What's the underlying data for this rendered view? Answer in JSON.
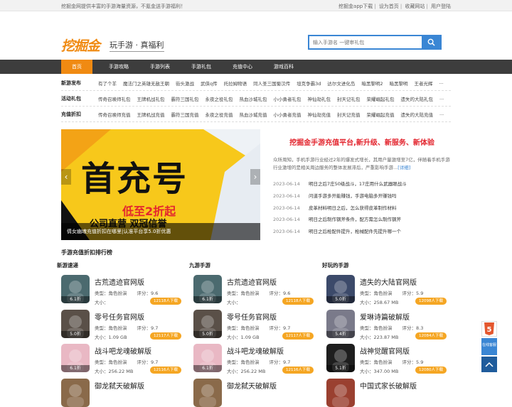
{
  "topbar": {
    "left_text": "挖掘金网提供丰富的手游海量资源，不氪金送手游福利！",
    "right_links": [
      "挖掘金app下载",
      "设为首页",
      "收藏网站",
      "用户登陆"
    ]
  },
  "header": {
    "logo_text": "挖掘金",
    "slogan": "玩手游 · 真福利",
    "search_placeholder": "输入手游名 一键审礼包"
  },
  "nav": {
    "items": [
      "首页",
      "手游攻略",
      "手游列表",
      "手游礼包",
      "充值中心",
      "游戏百科"
    ]
  },
  "categories": [
    {
      "title": "新游发布",
      "links": [
        "有了个羊",
        "魔法门之英雄无敌王朝",
        "街头激战",
        "武侠q传",
        "托拉姆物语",
        "同人圣三国蜀汉传",
        "坦克争霸3d",
        "达尔文进化岛",
        "暗黑黎明2",
        "暗黑黎明",
        "王者光辉",
        "..."
      ]
    },
    {
      "title": "活动礼包",
      "links": [
        "传奇召唤师礼包",
        "王牌机战礼包",
        "霸符三国礼包",
        "永夜之役礼包",
        "热血沙城礼包",
        "小小勇者礼包",
        "神仙劫礼包",
        "封天记礼包",
        "荣耀崛起礼包",
        "遗失的大陆礼包",
        "..."
      ]
    },
    {
      "title": "充值折扣",
      "links": [
        "传奇召唤师充值",
        "王牌机战充值",
        "霸符三国充值",
        "永夜之役充值",
        "热血沙城充值",
        "小小勇者充值",
        "神仙劫充值",
        "封天记充值",
        "荣耀崛起充值",
        "遗失的大陆充值",
        "..."
      ]
    }
  ],
  "banner": {
    "headline": "首充号",
    "subline": "低至2折起",
    "subline2": "公司直营  双冠信誉",
    "caption": "倩女幽魂充值折扣在哪里|认准平台享5.0折优惠",
    "prev_icon": "‹",
    "next_icon": "›"
  },
  "news": {
    "title": "挖掘金手游充值平台,新升级、新服务、新体验",
    "desc": "众所周知，手机手游行业经过2年的爆发式增长，其用户量激增至7亿，伴随着手机手游行业激增的是相关周边服务的整体发展滞后，严重影响手游...",
    "more": "[详细]",
    "items": [
      {
        "date": "2023-06-14",
        "title": "明日之后7庄50级战斗，17庄用什么武器眼战斗"
      },
      {
        "date": "2023-06-14",
        "title": "问道手游多开能赚钱，手游电脑多开赚钱吗"
      },
      {
        "date": "2023-06-14",
        "title": "皮革材料明日之后，怎么获得皮革制作材料"
      },
      {
        "date": "2023-06-14",
        "title": "明日之后制作钢斧条件，配方需怎么制作钢斧"
      },
      {
        "date": "2023-06-14",
        "title": "明日之后枪配件提升，枪械配件先提升哪一个"
      }
    ]
  },
  "ranking": {
    "section_title": "手游充值折扣排行榜",
    "columns": [
      {
        "title": "新游速递",
        "games": [
          {
            "name": "古荒遗迹官网版",
            "type": "类型：角色扮演",
            "score": "评分：9.6",
            "size": "大小：",
            "discount": "6.1折",
            "downloads": "12118人下载",
            "color": "#4b6a6f"
          },
          {
            "name": "零号任务官网版",
            "type": "类型：角色扮演",
            "score": "评分：9.7",
            "size": "大小：1.09 GB",
            "discount": "5.0折",
            "downloads": "12117人下载",
            "color": "#5a5048"
          },
          {
            "name": "战斗吧龙魂破解版",
            "type": "类型：角色扮演",
            "score": "评分：9.7",
            "size": "大小：256.22 MB",
            "discount": "6.1折",
            "downloads": "12116人下载",
            "color": "#e9b8c4"
          },
          {
            "name": "御龙弑天破解版",
            "type": "",
            "score": "",
            "size": "",
            "discount": "",
            "downloads": "",
            "color": "#8a6a4a"
          }
        ]
      },
      {
        "title": "九游手游",
        "games": [
          {
            "name": "古荒遗迹官网版",
            "type": "类型：角色扮演",
            "score": "评分：9.6",
            "size": "大小：",
            "discount": "6.1折",
            "downloads": "12118人下载",
            "color": "#4b6a6f"
          },
          {
            "name": "零号任务官网版",
            "type": "类型：角色扮演",
            "score": "评分：9.7",
            "size": "大小：1.09 GB",
            "discount": "5.0折",
            "downloads": "12117人下载",
            "color": "#5a5048"
          },
          {
            "name": "战斗吧龙魂破解版",
            "type": "类型：角色扮演",
            "score": "评分：9.7",
            "size": "大小：256.22 MB",
            "discount": "6.1折",
            "downloads": "12116人下载",
            "color": "#e9b8c4"
          },
          {
            "name": "御龙弑天破解版",
            "type": "",
            "score": "",
            "size": "",
            "discount": "",
            "downloads": "",
            "color": "#8a6a4a"
          }
        ]
      },
      {
        "title": "好玩的手游",
        "games": [
          {
            "name": "遗失的大陆官网版",
            "type": "类型：角色扮演",
            "score": "评分：5.9",
            "size": "大小：258.67 MB",
            "discount": "5.0折",
            "downloads": "12098人下载",
            "color": "#3c4a6a"
          },
          {
            "name": "爱琳诗篇破解版",
            "type": "类型：角色扮演",
            "score": "评分：8.3",
            "size": "大小：223.87 MB",
            "discount": "5.4折",
            "downloads": "12084人下载",
            "color": "#7a7a8a"
          },
          {
            "name": "战神觉醒官网版",
            "type": "类型：角色扮演",
            "score": "评分：5.9",
            "size": "大小：347.00 MB",
            "discount": "5.1折",
            "downloads": "12080人下载",
            "color": "#1e1e1e"
          },
          {
            "name": "中国式家长破解版",
            "type": "",
            "score": "",
            "size": "",
            "discount": "",
            "downloads": "",
            "color": "#9a4030"
          }
        ]
      }
    ]
  },
  "float": {
    "h5_label": "5",
    "kefu_label": "在线客服",
    "top_icon": "back-to-top"
  }
}
